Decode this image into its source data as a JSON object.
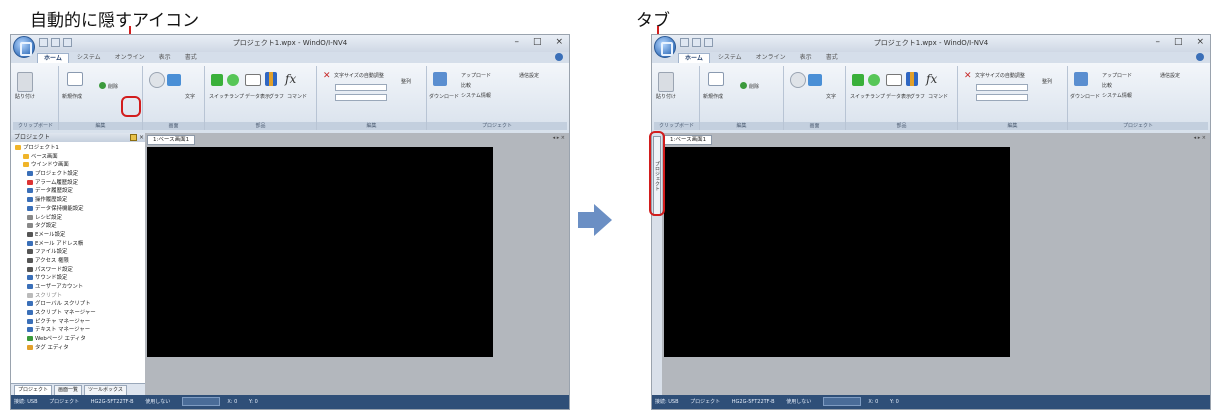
{
  "callouts": {
    "left": "自動的に隠すアイコン",
    "right": "タブ"
  },
  "colors": {
    "highlight": "#d21d1d",
    "arrow": "#6b8fc4",
    "canvas": "#000000",
    "statusbar": "#2f4f78"
  },
  "app": {
    "window_title": "プロジェクト1.wpx - WindO/I-NV4",
    "window_controls": [
      "–",
      "□",
      "×"
    ],
    "ribbon_tabs": [
      "ホーム",
      "システム",
      "オンライン",
      "表示",
      "書式"
    ],
    "ribbon_groups": [
      "クリップボード",
      "編集",
      "画面",
      "部品",
      "編集",
      "プロジェクト"
    ],
    "ribbon_items": {
      "paste": "貼り付け",
      "newscreen": "新規作成",
      "delete": "削除",
      "kiji": "画面",
      "text": "文字",
      "switch": "スイッチ",
      "lamp": "ランプ",
      "data_display": "データ表示",
      "graph": "グラフ",
      "command": "コマンド",
      "font_size": "文字サイズの自動調整",
      "align": "整列",
      "download": "ダウンロード",
      "upload": "アップロード",
      "compare": "比較",
      "sysinfo": "システム情報",
      "settings": "通信設定"
    },
    "panel_title": "プロジェクト",
    "tree_items": [
      "プロジェクト1",
      "ベース画面",
      "ウインドウ画面",
      "プロジェクト設定",
      "アラーム履歴設定",
      "データ履歴設定",
      "操作履歴設定",
      "データ保持機能設定",
      "レシピ設定",
      "タグ設定",
      "Eメール設定",
      "Eメール アドレス帳",
      "ファイル設定",
      "アクセス 権限",
      "パスワード設定",
      "サウンド設定",
      "ユーザーアカウント",
      "スクリプト",
      "グローバル スクリプト",
      "スクリプト マネージャー",
      "ピクチャ マネージャー",
      "テキスト マネージャー",
      "Webページ エディタ",
      "タグ エディタ"
    ],
    "panel_tabs": [
      "プロジェクト",
      "画面一覧",
      "ツールボックス"
    ],
    "doc_tab": "1:ベース画面1",
    "vertical_tab": "プロジェクト",
    "status_segments": [
      "接続: USB",
      "プロジェクト",
      "HG2G-5FT22TF-B",
      "使用しない",
      "X: 0",
      "Y: 0"
    ]
  }
}
